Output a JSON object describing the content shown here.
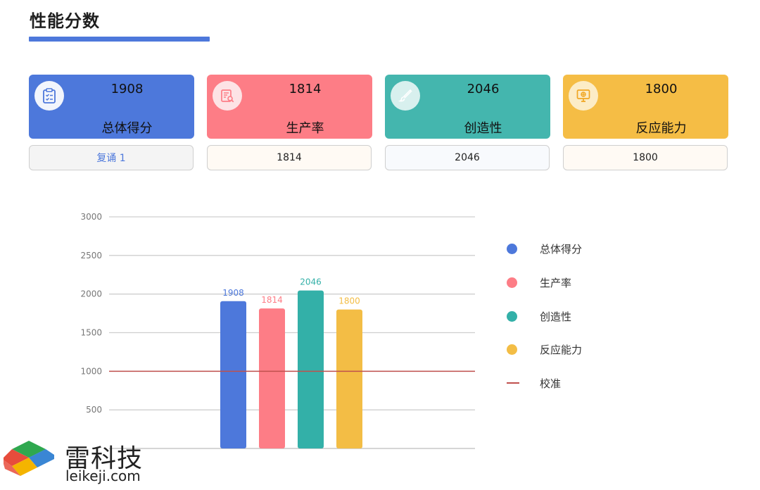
{
  "header": {
    "title": "性能分数"
  },
  "cards": [
    {
      "value": "1908",
      "label": "总体得分",
      "sub": "复诵 1",
      "color": "#4d78db",
      "circle_bg": "#f2f5fc",
      "sub_bg": "#f4f4f4",
      "sub_color": "#4d78db",
      "icon": "clipboard-icon"
    },
    {
      "value": "1814",
      "label": "生产率",
      "sub": "1814",
      "color": "#fd7d86",
      "circle_bg": "#fde3e5",
      "sub_bg": "#fffaf4",
      "sub_color": "#222222",
      "icon": "report-search-icon"
    },
    {
      "value": "2046",
      "label": "创造性",
      "sub": "2046",
      "color": "#44b6ae",
      "circle_bg": "#d8f0ee",
      "sub_bg": "#f8fafd",
      "sub_color": "#222222",
      "icon": "brush-icon"
    },
    {
      "value": "1800",
      "label": "反应能力",
      "sub": "1800",
      "color": "#f5bd45",
      "circle_bg": "#fcecc6",
      "sub_bg": "#fffaf4",
      "sub_color": "#222222",
      "icon": "monitor-icon"
    }
  ],
  "chart_data": {
    "type": "bar",
    "categories": [
      "总体得分",
      "生产率",
      "创造性",
      "反应能力"
    ],
    "values": [
      1908,
      1814,
      2046,
      1800
    ],
    "colors": [
      "#4d78db",
      "#fd7d86",
      "#33b0a8",
      "#f3bd45"
    ],
    "yticks": [
      500,
      1000,
      1500,
      2000,
      2500,
      3000
    ],
    "ylim": [
      0,
      3000
    ],
    "grid": true,
    "reference_line": {
      "name": "校准",
      "value": 1000,
      "color": "#c0504d"
    },
    "legend_position": "right"
  },
  "legend": [
    {
      "label": "总体得分",
      "color": "#4d78db",
      "kind": "dot"
    },
    {
      "label": "生产率",
      "color": "#fd7d86",
      "kind": "dot"
    },
    {
      "label": "创造性",
      "color": "#33b0a8",
      "kind": "dot"
    },
    {
      "label": "反应能力",
      "color": "#f3bd45",
      "kind": "dot"
    },
    {
      "label": "校准",
      "color": "#c0504d",
      "kind": "line"
    }
  ],
  "watermark": {
    "brand": "雷科技",
    "url": "leikeji.com"
  }
}
